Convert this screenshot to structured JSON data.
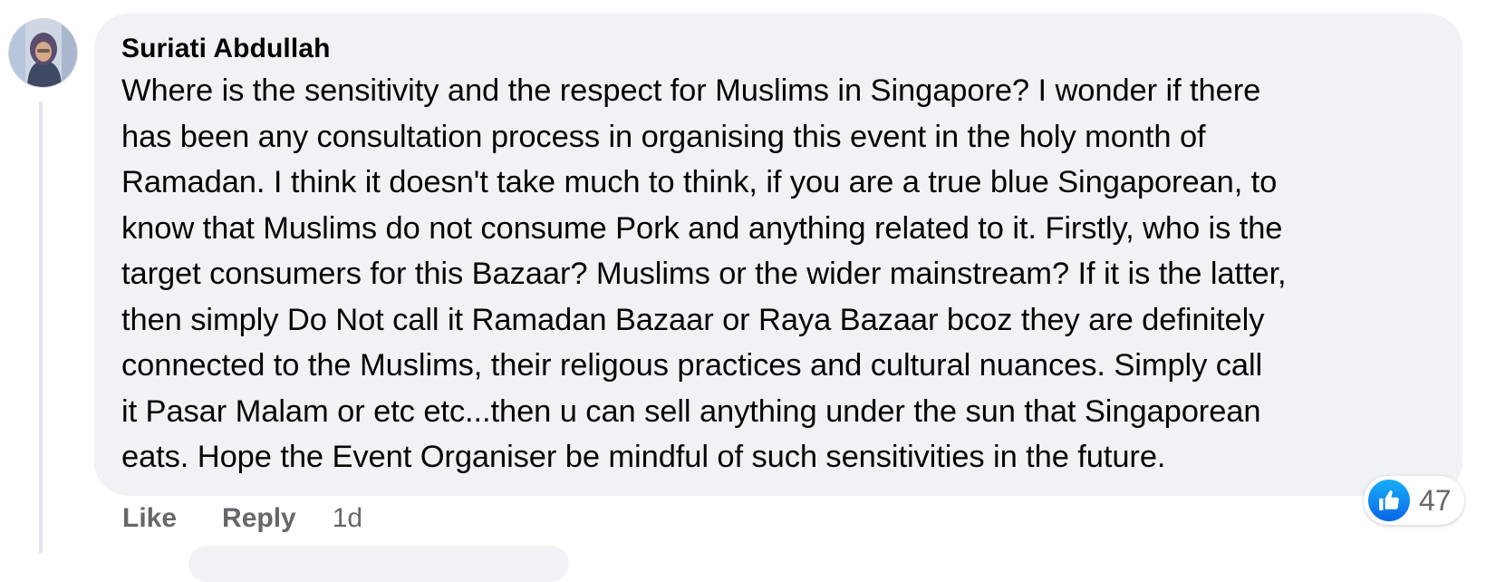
{
  "comment": {
    "author": "Suriati Abdullah",
    "lines": [
      "Where is the sensitivity and the respect for Muslims in Singapore? I wonder if there",
      "has been any consultation process in organising this event in the holy month of",
      "Ramadan. I think it doesn't take much to think, if you are a true blue Singaporean, to",
      "know that Muslims do not consume Pork and anything related to it. Firstly, who is the",
      "target consumers for this Bazaar? Muslims or the wider mainstream? If it is the latter,",
      "then simply Do Not call it Ramadan Bazaar or Raya Bazaar bcoz they are definitely",
      "connected to the Muslims, their religous practices and cultural nuances. Simply call",
      "it Pasar Malam or etc etc...then u can sell anything under the sun that Singaporean",
      "eats. Hope the Event Organiser be mindful of such sensitivities in the future."
    ],
    "reaction_icon": "like-icon",
    "reaction_count": "47"
  },
  "actions": {
    "like_label": "Like",
    "reply_label": "Reply",
    "timestamp": "1d"
  },
  "colors": {
    "bubble_bg": "#f0f2f5",
    "secondary_text": "#65676b",
    "like_blue": "#1877f2"
  }
}
